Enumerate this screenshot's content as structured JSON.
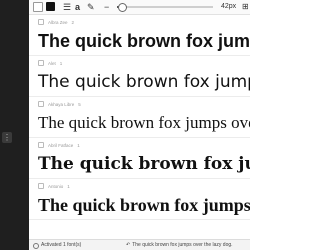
{
  "toolbar": {
    "icons": [
      "white-swatch",
      "black-swatch",
      "list-icon",
      "text-size-icon",
      "sample-text-icon",
      "minus-icon"
    ],
    "size_label": "42px",
    "size_value_percent": 0.05,
    "right_icon": "⊞"
  },
  "fonts": [
    {
      "name": "Albra Zee",
      "count": "2",
      "sample": "The quick brown fox jumps ov"
    },
    {
      "name": "Alet",
      "count": "1",
      "sample": "The quick brown fox jumps over the"
    },
    {
      "name": "Akhaya Libre",
      "count": "5",
      "sample": "The quick brown fox jumps over the l"
    },
    {
      "name": "Abril Fatface",
      "count": "1",
      "sample": "The quick brown fox jumps ov"
    },
    {
      "name": "Antonio",
      "count": "1",
      "sample": "The quick brown fox jumps o"
    }
  ],
  "status": {
    "activated": "Activated 1 font(s)",
    "sample_preview": "The quick brown fox jumps over the lazy dog."
  },
  "colors": {
    "sidebar_bg": "#1f1f1f",
    "toolbar_bg": "#fafafa",
    "text": "#111111"
  }
}
